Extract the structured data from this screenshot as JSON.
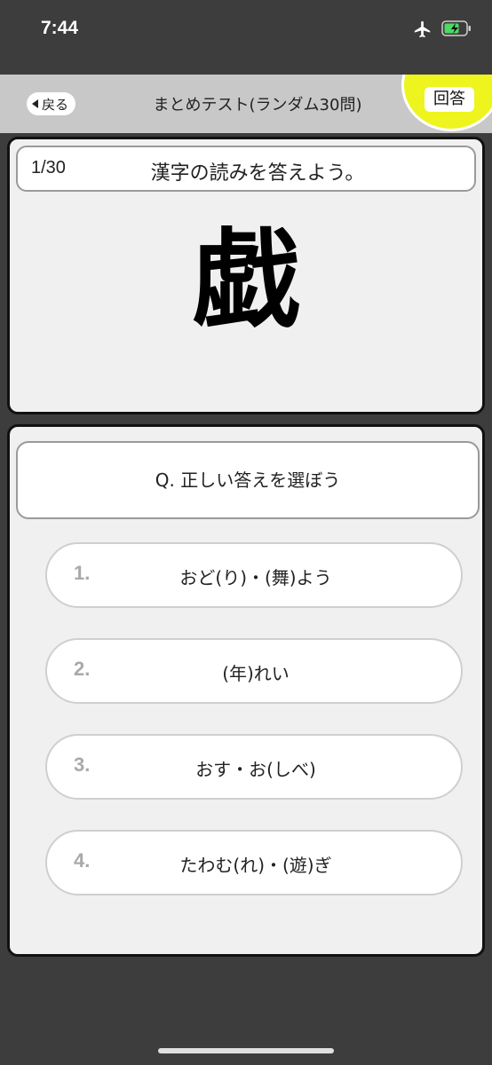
{
  "status_bar": {
    "time": "7:44",
    "icons": [
      "airplane-icon",
      "battery-icon"
    ],
    "battery_color": "#4cd964"
  },
  "nav": {
    "back_label": "戻る",
    "title": "まとめテスト(ランダム30問)",
    "answer_label": "回答",
    "accent_color": "#eef41e"
  },
  "question": {
    "counter": "1/30",
    "instruction": "漢字の読みを答えよう。",
    "kanji": "戯"
  },
  "choices": {
    "prompt": "Q. 正しい答えを選ぼう",
    "items": [
      {
        "number": "1.",
        "text": "おど(り)・(舞)よう"
      },
      {
        "number": "2.",
        "text": "(年)れい"
      },
      {
        "number": "3.",
        "text": "おす・お(しべ)"
      },
      {
        "number": "4.",
        "text": "たわむ(れ)・(遊)ぎ"
      }
    ]
  }
}
